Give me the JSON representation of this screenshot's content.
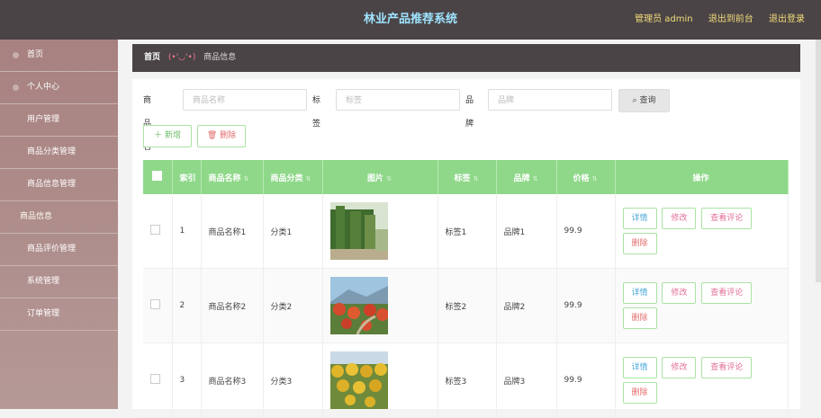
{
  "header": {
    "title": "林业产品推荐系统",
    "admin": "管理员 admin",
    "front": "退出到前台",
    "logout": "退出登录"
  },
  "sidebar": {
    "items": [
      {
        "label": "首页"
      },
      {
        "label": "个人中心"
      },
      {
        "label": "用户管理"
      },
      {
        "label": "商品分类管理"
      },
      {
        "label": "商品信息管理"
      },
      {
        "label": "商品信息"
      },
      {
        "label": "商品评价管理"
      },
      {
        "label": "系统管理"
      },
      {
        "label": "订单管理"
      }
    ]
  },
  "breadcrumb": {
    "home": "首页",
    "emoticon": "(•'◡'•)",
    "current": "商品信息"
  },
  "search": {
    "name_label": "商品名称",
    "name_placeholder": "商品名称",
    "tag_label": "标签",
    "tag_placeholder": "标签",
    "brand_label": "品牌",
    "brand_placeholder": "品牌",
    "query_label": "查询"
  },
  "actions": {
    "add": "新增",
    "delete": "删除"
  },
  "table": {
    "headers": [
      "索引",
      "商品名称",
      "商品分类",
      "图片",
      "标签",
      "品牌",
      "价格",
      "操作"
    ],
    "rows": [
      {
        "index": "1",
        "name": "商品名称1",
        "category": "分类1",
        "tag": "标签1",
        "brand": "品牌1",
        "price": "99.9"
      },
      {
        "index": "2",
        "name": "商品名称2",
        "category": "分类2",
        "tag": "标签2",
        "brand": "品牌2",
        "price": "99.9"
      },
      {
        "index": "3",
        "name": "商品名称3",
        "category": "分类3",
        "tag": "标签3",
        "brand": "品牌3",
        "price": "99.9"
      }
    ],
    "ops": {
      "detail": "详情",
      "edit": "修改",
      "reviews": "查看评论",
      "delete": "删除"
    }
  }
}
